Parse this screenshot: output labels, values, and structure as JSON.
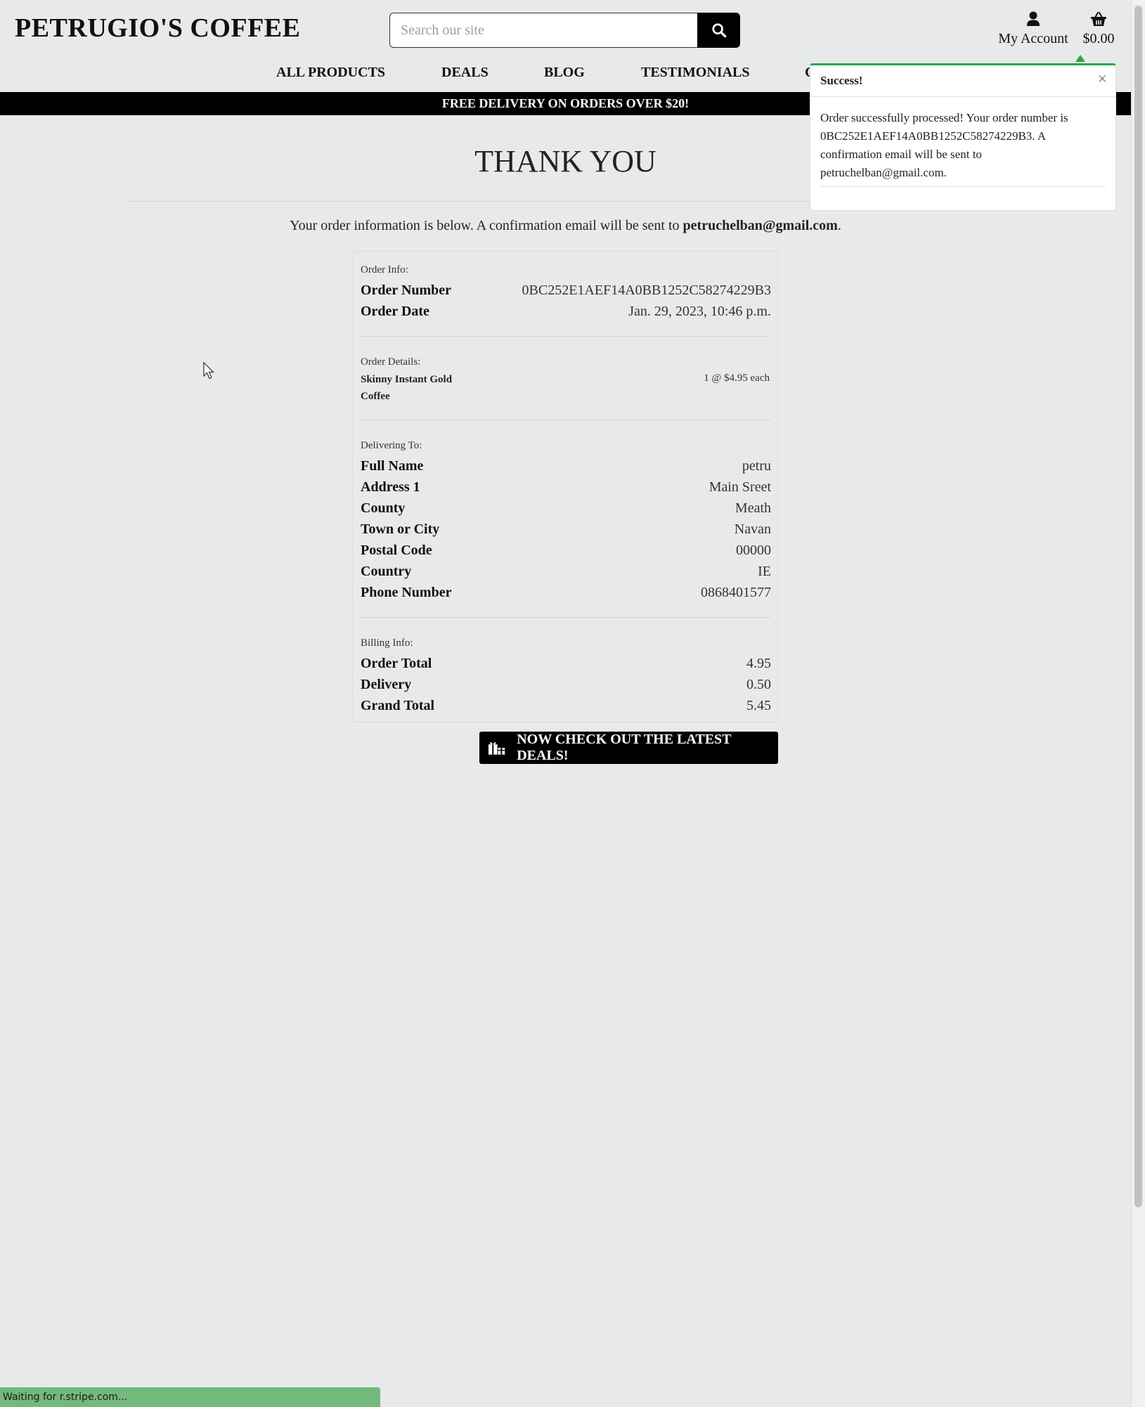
{
  "header": {
    "logo": "PETRUGIO'S COFFEE",
    "search_placeholder": "Search our site",
    "account_label": "My Account",
    "bag_total": "$0.00"
  },
  "nav": {
    "items": [
      "ALL PRODUCTS",
      "DEALS",
      "BLOG",
      "TESTIMONIALS",
      "C"
    ]
  },
  "banner": "FREE DELIVERY ON ORDERS OVER $20!",
  "main": {
    "title": "THANK YOU",
    "intro_prefix": "Your order information is below. A confirmation email will be sent to ",
    "intro_email": "petruchelban@gmail.com",
    "intro_suffix": "."
  },
  "order": {
    "info_label": "Order Info:",
    "order_number_label": "Order Number",
    "order_number": "0BC252E1AEF14A0BB1252C58274229B3",
    "order_date_label": "Order Date",
    "order_date": "Jan. 29, 2023, 10:46 p.m.",
    "details_label": "Order Details:",
    "item_name": "Skinny Instant Gold Coffee",
    "item_qty": "1 @ $4.95 each",
    "delivering_label": "Delivering To:",
    "delivery": [
      {
        "label": "Full Name",
        "value": "petru"
      },
      {
        "label": "Address 1",
        "value": "Main Sreet"
      },
      {
        "label": "County",
        "value": "Meath"
      },
      {
        "label": "Town or City",
        "value": "Navan"
      },
      {
        "label": "Postal Code",
        "value": "00000"
      },
      {
        "label": "Country",
        "value": "IE"
      },
      {
        "label": "Phone Number",
        "value": "0868401577"
      }
    ],
    "billing_label": "Billing Info:",
    "billing": [
      {
        "label": "Order Total",
        "value": "4.95"
      },
      {
        "label": "Delivery",
        "value": "0.50"
      },
      {
        "label": "Grand Total",
        "value": "5.45"
      }
    ]
  },
  "deals_button": "NOW CHECK OUT THE LATEST DEALS!",
  "toast": {
    "title": "Success!",
    "close": "×",
    "message": "Order successfully processed! Your order number is 0BC252E1AEF14A0BB1252C58274229B3. A confirmation email will be sent to petruchelban@gmail.com.",
    "accent_color": "#28a745"
  },
  "status_bar": "Waiting for r.stripe.com..."
}
